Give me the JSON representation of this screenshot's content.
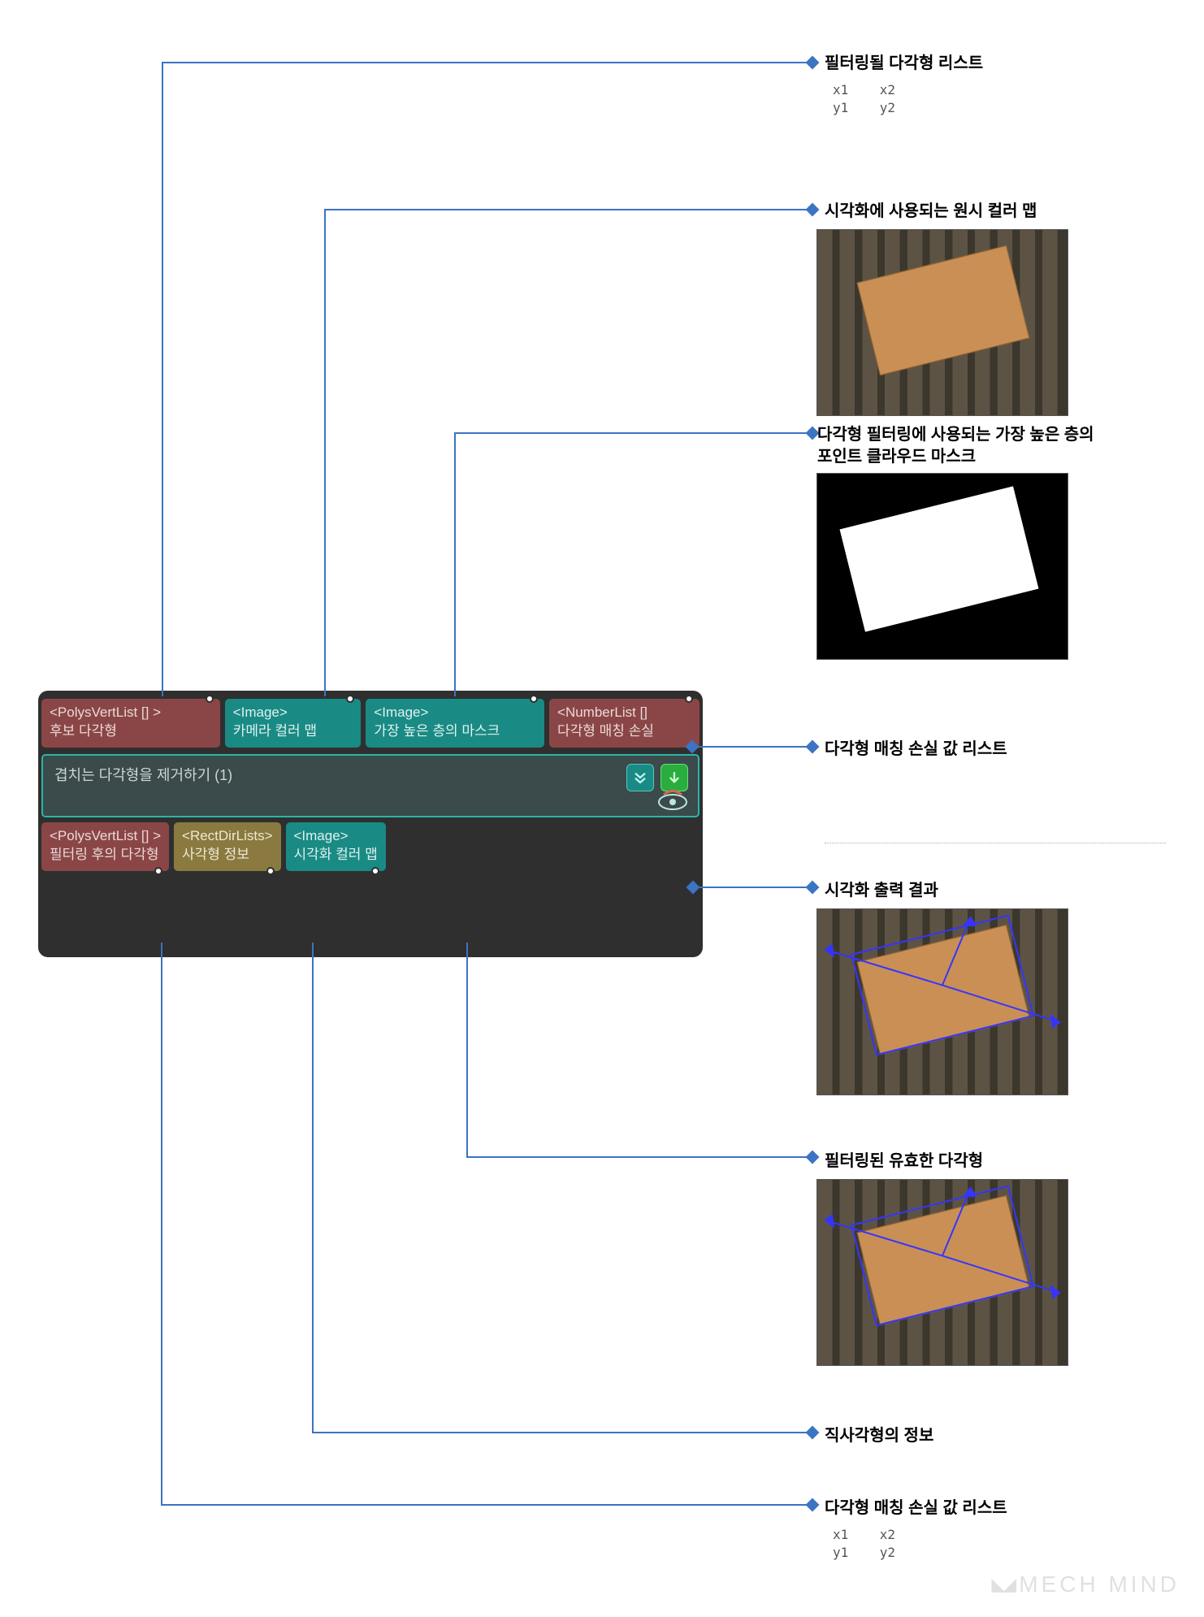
{
  "labels": {
    "l1": {
      "title": "필터링될 다각형 리스트",
      "sub": "x1    x2\ny1    y2"
    },
    "l2": {
      "title": "시각화에 사용되는 원시 컬러 맵"
    },
    "l3": {
      "title": "다각형 필터링에 사용되는 가장 높은 층의\n포인트 클라우드 마스크"
    },
    "l4": {
      "title": "다각형 매칭 손실 값 리스트"
    },
    "l5": {
      "title": "시각화 출력 결과"
    },
    "l6": {
      "title": "필터링된 유효한 다각형"
    },
    "l7": {
      "title": "직사각형의 정보"
    },
    "l8": {
      "title": "다각형 매칭 손실 값 리스트",
      "sub": "x1    x2\ny1    y2"
    }
  },
  "node": {
    "title": "겹치는 다각형을 제거하기 (1)",
    "inputs": [
      {
        "type": "<PolysVertList [] >",
        "name": "후보 다각형",
        "color": "maroon"
      },
      {
        "type": "<Image>",
        "name": "카메라 컬러 맵",
        "color": "teal"
      },
      {
        "type": "<Image>",
        "name": "가장 높은 층의 마스크",
        "color": "teal"
      },
      {
        "type": "<NumberList []",
        "name": "다각형 매칭 손실",
        "color": "maroon"
      }
    ],
    "outputs": [
      {
        "type": "<PolysVertList [] >",
        "name": "필터링 후의 다각형",
        "color": "maroon"
      },
      {
        "type": "<RectDirLists>",
        "name": "사각형 정보",
        "color": "olive"
      },
      {
        "type": "<Image>",
        "name": "시각화 컬러 맵",
        "color": "teal"
      }
    ]
  },
  "watermark": "MECH MIND"
}
